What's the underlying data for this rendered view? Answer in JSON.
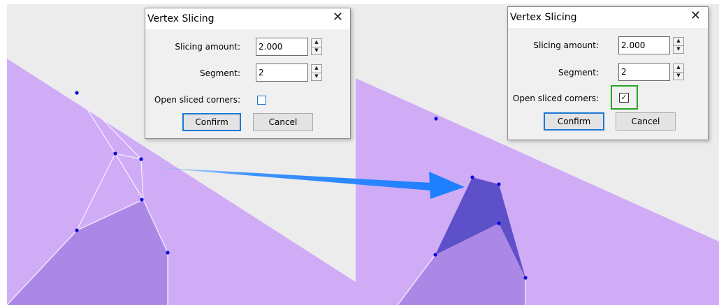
{
  "dialog_left": {
    "title": "Vertex Slicing",
    "close_glyph": "✕",
    "slicing_amount_label": "Slicing amount:",
    "slicing_amount_value": "2.000",
    "segment_label": "Segment:",
    "segment_value": "2",
    "open_corners_label": "Open sliced corners:",
    "open_corners_checked": false,
    "confirm_label": "Confirm",
    "cancel_label": "Cancel"
  },
  "dialog_right": {
    "title": "Vertex Slicing",
    "close_glyph": "✕",
    "slicing_amount_label": "Slicing amount:",
    "slicing_amount_value": "2.000",
    "segment_label": "Segment:",
    "segment_value": "2",
    "open_corners_label": "Open sliced corners:",
    "open_corners_checked": true,
    "check_glyph": "✓",
    "confirm_label": "Confirm",
    "cancel_label": "Cancel"
  },
  "spin_glyphs": {
    "up": "▲",
    "down": "▼"
  },
  "colors": {
    "canvas_bg": "#ececec",
    "light_purple": "#d0acf7",
    "medium_purple": "#ac88e6",
    "dark_purple": "#5e50c8",
    "vertex_blue": "#0a0ad8",
    "arrow_blue": "#1e7fff",
    "highlight_green": "#22a622",
    "primary_button_border": "#1c78d6"
  }
}
